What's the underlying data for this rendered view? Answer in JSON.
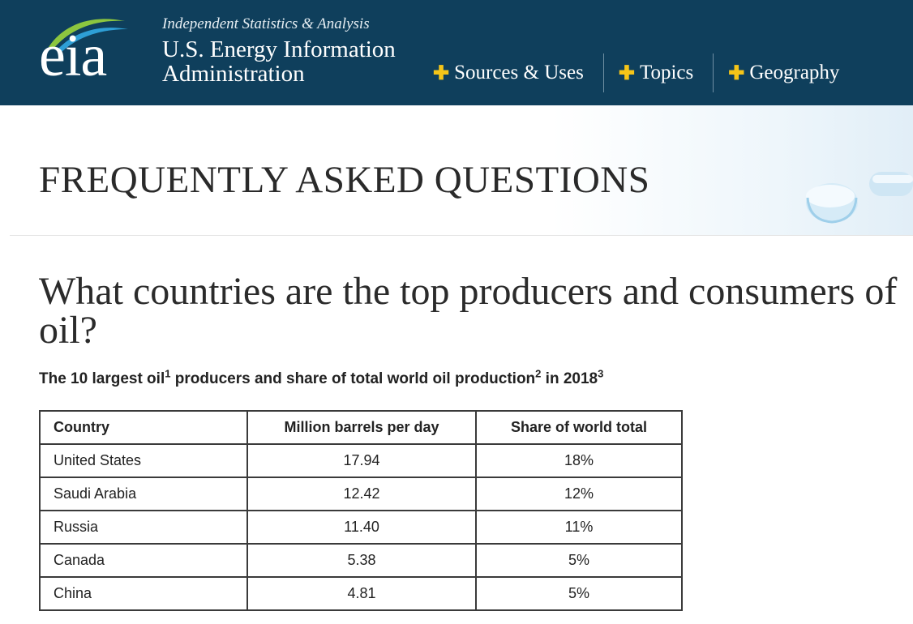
{
  "header": {
    "logo_text": "eia",
    "tagline": "Independent Statistics & Analysis",
    "agency_line1": "U.S. Energy Information",
    "agency_line2": "Administration",
    "nav": [
      {
        "label": "Sources & Uses"
      },
      {
        "label": "Topics"
      },
      {
        "label": "Geography"
      }
    ],
    "colors": {
      "background": "#0f3f5c",
      "nav_plus": "#f5c518"
    }
  },
  "banner": {
    "title": "FREQUENTLY ASKED QUESTIONS"
  },
  "question": {
    "title": "What countries are the top producers and consumers of oil?"
  },
  "caption": {
    "part1": "The 10 largest oil",
    "sup1": "1",
    "part2": " producers and share of total world oil production",
    "sup2": "2",
    "part3": " in 2018",
    "sup3": "3"
  },
  "table": {
    "headers": [
      "Country",
      "Million barrels per day",
      "Share of world total"
    ],
    "rows": [
      [
        "United States",
        "17.94",
        "18%"
      ],
      [
        "Saudi Arabia",
        "12.42",
        "12%"
      ],
      [
        "Russia",
        "11.40",
        "11%"
      ],
      [
        "Canada",
        "5.38",
        "5%"
      ],
      [
        "China",
        "4.81",
        "5%"
      ]
    ]
  }
}
